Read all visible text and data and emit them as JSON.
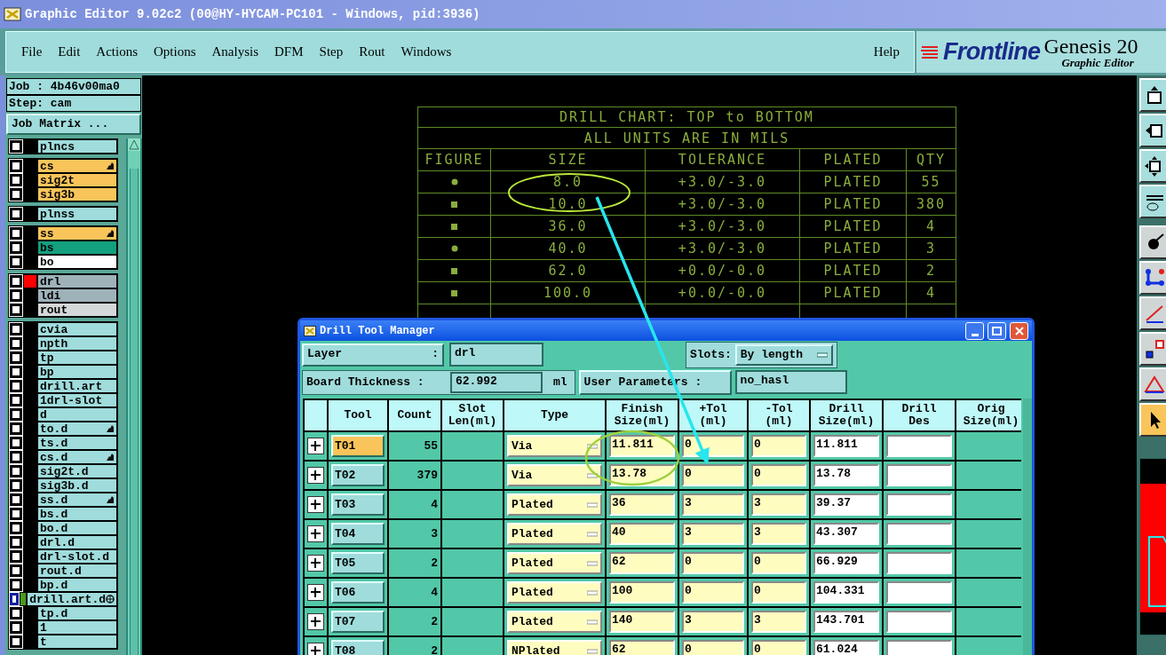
{
  "window": {
    "title": "Graphic Editor 9.02c2 (00@HY-HYCAM-PC101 - Windows, pid:3936)"
  },
  "menu": {
    "items": [
      "File",
      "Edit",
      "Actions",
      "Options",
      "Analysis",
      "DFM",
      "Step",
      "Rout",
      "Windows"
    ],
    "help": "Help"
  },
  "logo": {
    "brand": "Frontline",
    "product": "Genesis 20",
    "subtitle": "Graphic Editor"
  },
  "job_panel": {
    "job": "Job : 4b46v00ma0",
    "step": "Step: cam",
    "matrix_button": "Job Matrix ..."
  },
  "layer_groups": [
    {
      "layers": [
        {
          "name": "plncs",
          "color": "#a0dcdc",
          "kind": "plain",
          "checked": false
        }
      ]
    },
    {
      "layers": [
        {
          "name": "cs",
          "color": "#f9c55a",
          "kind": "hand",
          "checked": false
        },
        {
          "name": "sig2t",
          "color": "#f9c55a",
          "kind": "plain",
          "checked": false
        },
        {
          "name": "sig3b",
          "color": "#f9c55a",
          "kind": "plain",
          "checked": false
        }
      ]
    },
    {
      "layers": [
        {
          "name": "plnss",
          "color": "#a0dcdc",
          "kind": "plain",
          "checked": false
        }
      ]
    },
    {
      "layers": [
        {
          "name": "ss",
          "color": "#f9c55a",
          "kind": "hand",
          "checked": false
        },
        {
          "name": "bs",
          "color": "#12a07f",
          "kind": "plain",
          "checked": false
        },
        {
          "name": "bo",
          "color": "#ffffff",
          "kind": "plain",
          "checked": false
        }
      ]
    },
    {
      "layers": [
        {
          "name": "drl",
          "color": "#9fb2ba",
          "swatch": {
            "color": "#ff0000"
          },
          "kind": "plain",
          "checked": false
        },
        {
          "name": "ldi",
          "color": "#9fb2ba",
          "kind": "plain",
          "checked": false
        },
        {
          "name": "rout",
          "color": "#d5d8d8",
          "kind": "plain",
          "checked": false
        }
      ]
    },
    {
      "layers": [
        {
          "name": "cvia",
          "color": "#a0dcdc",
          "kind": "plain",
          "checked": false
        },
        {
          "name": "npth",
          "color": "#a0dcdc",
          "kind": "plain",
          "checked": false
        },
        {
          "name": "tp",
          "color": "#a0dcdc",
          "kind": "plain",
          "checked": false
        },
        {
          "name": "bp",
          "color": "#a0dcdc",
          "kind": "plain",
          "checked": false
        },
        {
          "name": "drill.art",
          "color": "#a0dcdc",
          "kind": "plain",
          "checked": false
        },
        {
          "name": "1drl-slot",
          "color": "#a0dcdc",
          "kind": "plain",
          "checked": false
        },
        {
          "name": "d",
          "color": "#a0dcdc",
          "kind": "plain",
          "checked": false
        },
        {
          "name": "to.d",
          "color": "#a0dcdc",
          "kind": "hand",
          "checked": false
        },
        {
          "name": "ts.d",
          "color": "#a0dcdc",
          "kind": "plain",
          "checked": false
        },
        {
          "name": "cs.d",
          "color": "#a0dcdc",
          "kind": "hand",
          "checked": false
        },
        {
          "name": "sig2t.d",
          "color": "#a0dcdc",
          "kind": "plain",
          "checked": false
        },
        {
          "name": "sig3b.d",
          "color": "#a0dcdc",
          "kind": "plain",
          "checked": false
        },
        {
          "name": "ss.d",
          "color": "#a0dcdc",
          "kind": "hand",
          "checked": false
        },
        {
          "name": "bs.d",
          "color": "#a0dcdc",
          "kind": "plain",
          "checked": false
        },
        {
          "name": "bo.d",
          "color": "#a0dcdc",
          "kind": "plain",
          "checked": false
        },
        {
          "name": "drl.d",
          "color": "#a0dcdc",
          "kind": "plain",
          "checked": false
        },
        {
          "name": "drl-slot.d",
          "color": "#a0dcdc",
          "kind": "plain",
          "checked": false
        },
        {
          "name": "rout.d",
          "color": "#a0dcdc",
          "kind": "plain",
          "checked": false
        },
        {
          "name": "bp.d",
          "color": "#a0dcdc",
          "kind": "plain",
          "checked": false
        },
        {
          "name": "drill.art.d",
          "color": "#a0dcdc",
          "swatch": {
            "color": "#4a9a1a"
          },
          "kind": "target",
          "checked": false
        },
        {
          "name": "tp.d",
          "color": "#a0dcdc",
          "kind": "plain",
          "checked": false
        },
        {
          "name": "1",
          "color": "#a0dcdc",
          "kind": "plain",
          "checked": false
        },
        {
          "name": "t",
          "color": "#a0dcdc",
          "kind": "plain",
          "checked": false
        }
      ]
    }
  ],
  "drill_chart": {
    "title": "DRILL CHART: TOP to BOTTOM",
    "subtitle": "ALL UNITS ARE IN MILS",
    "columns": [
      "FIGURE",
      "SIZE",
      "TOLERANCE",
      "PLATED",
      "QTY"
    ],
    "rows": [
      {
        "kind": "circle",
        "cells": [
          "",
          "8.0",
          "+3.0/-3.0",
          "PLATED",
          "55"
        ]
      },
      {
        "kind": "square",
        "cells": [
          "",
          "10.0",
          "+3.0/-3.0",
          "PLATED",
          "380"
        ]
      },
      {
        "kind": "square",
        "cells": [
          "",
          "36.0",
          "+3.0/-3.0",
          "PLATED",
          "4"
        ]
      },
      {
        "kind": "circle",
        "cells": [
          "",
          "40.0",
          "+3.0/-3.0",
          "PLATED",
          "3"
        ]
      },
      {
        "kind": "square",
        "cells": [
          "",
          "62.0",
          "+0.0/-0.0",
          "PLATED",
          "2"
        ]
      },
      {
        "kind": "square",
        "cells": [
          "",
          "100.0",
          "+0.0/-0.0",
          "PLATED",
          "4"
        ]
      }
    ]
  },
  "dialog": {
    "title": "Drill Tool Manager",
    "layer_label": "Layer",
    "layer_colon": ":",
    "layer_value": "drl",
    "slots_label": "Slots:",
    "slots_value": "By length",
    "thickness_label": "Board Thickness :",
    "thickness_value": "62.992",
    "thickness_unit": "ml",
    "user_params_button": "User Parameters :",
    "user_params_value": "no_hasl",
    "columns": [
      "Tool",
      "Count",
      "Slot\nLen(ml)",
      "Type",
      "Finish\nSize(ml)",
      "+Tol\n(ml)",
      "-Tol\n(ml)",
      "Drill\nSize(ml)",
      "Drill\nDes",
      "Orig\nSize(ml)"
    ],
    "rows": [
      {
        "tool": "T01",
        "selected": true,
        "count": "55",
        "type": "Via",
        "finish": "11.811",
        "plus_tol": "0",
        "minus_tol": "0",
        "drill_size": "11.811"
      },
      {
        "tool": "T02",
        "selected": false,
        "count": "379",
        "type": "Via",
        "finish": "13.78",
        "plus_tol": "0",
        "minus_tol": "0",
        "drill_size": "13.78"
      },
      {
        "tool": "T03",
        "selected": false,
        "count": "4",
        "type": "Plated",
        "finish": "36",
        "plus_tol": "3",
        "minus_tol": "3",
        "drill_size": "39.37"
      },
      {
        "tool": "T04",
        "selected": false,
        "count": "3",
        "type": "Plated",
        "finish": "40",
        "plus_tol": "3",
        "minus_tol": "3",
        "drill_size": "43.307"
      },
      {
        "tool": "T05",
        "selected": false,
        "count": "2",
        "type": "Plated",
        "finish": "62",
        "plus_tol": "0",
        "minus_tol": "0",
        "drill_size": "66.929"
      },
      {
        "tool": "T06",
        "selected": false,
        "count": "4",
        "type": "Plated",
        "finish": "100",
        "plus_tol": "0",
        "minus_tol": "0",
        "drill_size": "104.331"
      },
      {
        "tool": "T07",
        "selected": false,
        "count": "2",
        "type": "Plated",
        "finish": "140",
        "plus_tol": "3",
        "minus_tol": "3",
        "drill_size": "143.701"
      },
      {
        "tool": "T08",
        "selected": false,
        "count": "2",
        "type": "NPlated",
        "finish": "62",
        "plus_tol": "0",
        "minus_tol": "0",
        "drill_size": "61.024"
      }
    ]
  },
  "toolbar": {
    "buttons": [
      {
        "kind": "up",
        "selected": false
      },
      {
        "kind": "left",
        "selected": false
      },
      {
        "kind": "fit",
        "selected": false
      },
      {
        "kind": "measure",
        "selected": false
      },
      {
        "kind": "pad",
        "selected": false
      },
      {
        "kind": "net",
        "selected": false
      },
      {
        "kind": "line",
        "selected": false
      },
      {
        "kind": "snap",
        "selected": false
      },
      {
        "kind": "drc",
        "selected": false
      },
      {
        "kind": "pointer",
        "selected": true
      }
    ]
  }
}
